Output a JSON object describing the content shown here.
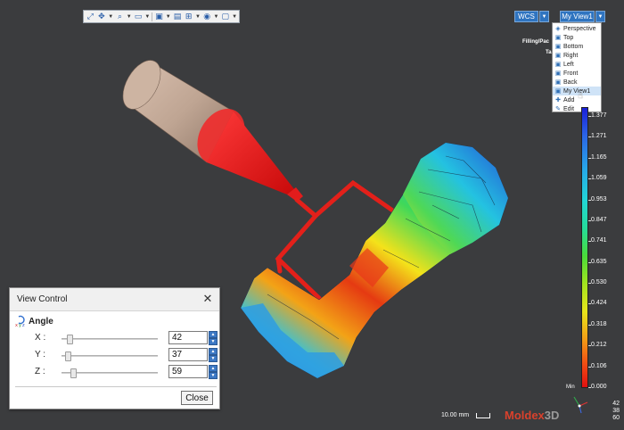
{
  "toolbar": {
    "icons": [
      "fit-icon",
      "pan-icon",
      "zoom-icon",
      "view-frame-icon",
      "cube-icon",
      "save-view-icon",
      "grid-icon",
      "eye-icon",
      "display-mode-icon"
    ]
  },
  "coord_system": {
    "label": "WCS"
  },
  "view_selector": {
    "label": "My View1",
    "menu": [
      {
        "label": "Perspective",
        "icon": "perspective-icon"
      },
      {
        "label": "Top",
        "icon": "top-view-icon"
      },
      {
        "label": "Bottom",
        "icon": "bottom-view-icon"
      },
      {
        "label": "Right",
        "icon": "right-view-icon"
      },
      {
        "label": "Left",
        "icon": "left-view-icon"
      },
      {
        "label": "Front",
        "icon": "front-view-icon"
      },
      {
        "label": "Back",
        "icon": "back-view-icon"
      },
      {
        "label": "My View1",
        "icon": "user-view-icon",
        "selected": true
      },
      {
        "label": "Add",
        "icon": "add-icon"
      },
      {
        "label": "Edit",
        "icon": "edit-icon"
      }
    ]
  },
  "info_panel": {
    "line1": "Filling/Pac",
    "line2": "Ta"
  },
  "legend": {
    "max_label": "",
    "labels": [
      "1.377",
      "1.271",
      "1.165",
      "1.059",
      "0.953",
      "0.847",
      "0.741",
      "0.635",
      "0.530",
      "0.424",
      "0.318",
      "0.212",
      "0.106",
      "0.000"
    ],
    "min_label": "Min",
    "colors": {
      "top": "#1a20d8",
      "bottom": "#e01010"
    }
  },
  "view_control": {
    "title": "View Control",
    "section": "Angle",
    "axes": [
      {
        "label": "X :",
        "value": "42",
        "fraction": 0.06
      },
      {
        "label": "Y :",
        "value": "37",
        "fraction": 0.04
      },
      {
        "label": "Z :",
        "value": "59",
        "fraction": 0.1
      }
    ],
    "close_label": "Close"
  },
  "status": {
    "scale": "10.00 mm",
    "brand_main": "Moldex",
    "brand_suffix": "3D",
    "angles": [
      "42",
      "38",
      "60"
    ]
  }
}
